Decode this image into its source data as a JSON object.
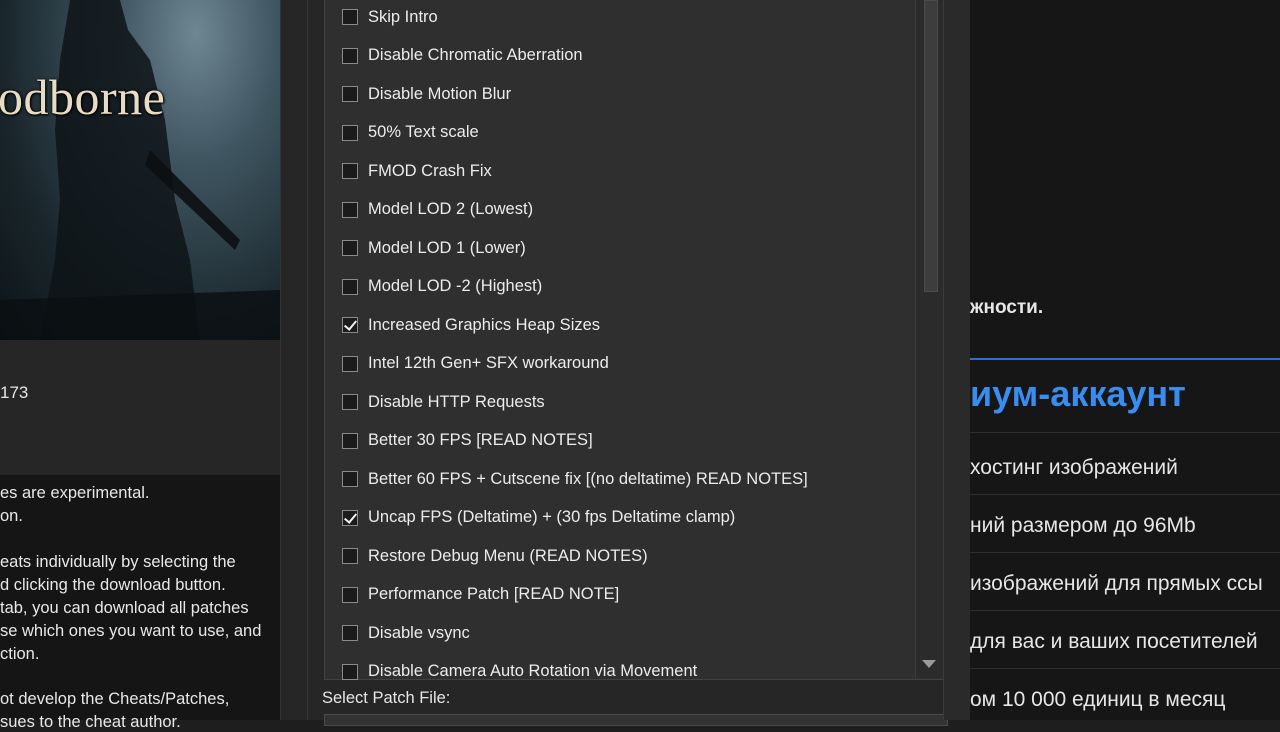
{
  "left": {
    "cover_title": "odborne",
    "number": "173",
    "notes_lines": [
      "es are experimental.",
      "on.",
      "",
      "eats individually by selecting the",
      "d clicking the download button.",
      " tab, you can download all patches",
      "se which ones you want to use, and",
      "ction.",
      "",
      "ot develop the Cheats/Patches,",
      "sues to the cheat author."
    ]
  },
  "patch_list": {
    "items": [
      {
        "label": "Skip Intro",
        "checked": false
      },
      {
        "label": "Disable Chromatic Aberration",
        "checked": false
      },
      {
        "label": "Disable Motion Blur",
        "checked": false
      },
      {
        "label": "50% Text scale",
        "checked": false
      },
      {
        "label": "FMOD Crash Fix",
        "checked": false
      },
      {
        "label": "Model LOD 2 (Lowest)",
        "checked": false
      },
      {
        "label": "Model LOD 1 (Lower)",
        "checked": false
      },
      {
        "label": "Model LOD -2 (Highest)",
        "checked": false
      },
      {
        "label": "Increased Graphics Heap Sizes",
        "checked": true
      },
      {
        "label": "Intel 12th Gen+ SFX workaround",
        "checked": false
      },
      {
        "label": "Disable HTTP Requests",
        "checked": false
      },
      {
        "label": "Better 30 FPS [READ NOTES]",
        "checked": false
      },
      {
        "label": "Better 60 FPS + Cutscene fix [(no deltatime) READ NOTES]",
        "checked": false
      },
      {
        "label": "Uncap FPS (Deltatime) + (30 fps Deltatime clamp)",
        "checked": true
      },
      {
        "label": "Restore Debug Menu (READ NOTES)",
        "checked": false
      },
      {
        "label": "Performance Patch [READ NOTE]",
        "checked": false
      },
      {
        "label": "Disable vsync",
        "checked": false
      },
      {
        "label": "Disable Camera Auto Rotation via Movement",
        "checked": false
      }
    ],
    "select_label": "Select Patch File:"
  },
  "right": {
    "line1": "жности.",
    "heading": "иум-аккаунт",
    "features": [
      "хостинг изображений",
      "ний размером до 96Mb",
      "изображений для прямых ссы",
      "для вас и ваших посетителей",
      "ом 10 000 единиц в месяц"
    ]
  }
}
